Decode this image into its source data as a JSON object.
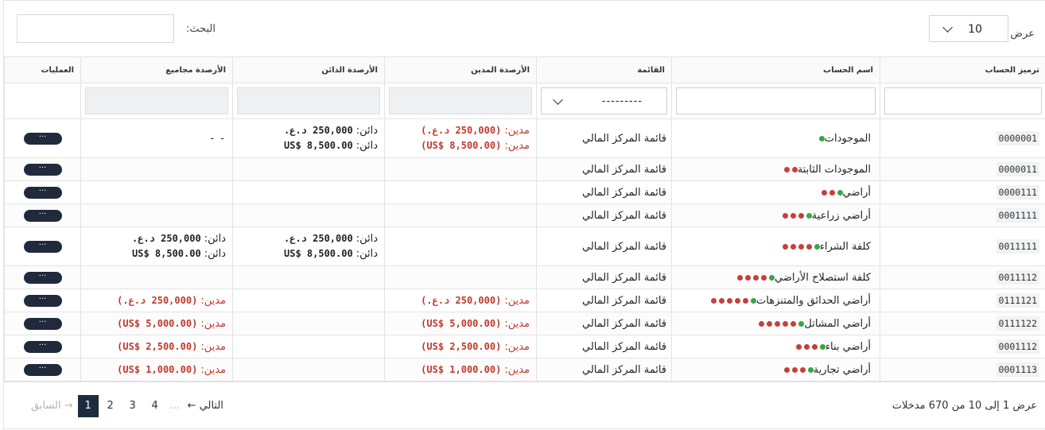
{
  "controls": {
    "show_label": "عرض",
    "page_size": "10",
    "search_label": "البحث:",
    "search_value": ""
  },
  "columns": {
    "code": "ترميز الحساب",
    "name": "اسم الحساب",
    "list": "القائمة",
    "debit": "الأرصدة المدين",
    "credit": "الأرصدة الدائن",
    "totals": "الأرصدة مجاميع",
    "ops": "العمليات"
  },
  "filters": {
    "list_placeholder": "---------"
  },
  "labels": {
    "debit": "مدين:",
    "credit": "دائن:",
    "ops_button": "···",
    "dash": "- -"
  },
  "rows": [
    {
      "code": "0000001",
      "name": "الموجودات",
      "red_dots": 0,
      "green_dots": 1,
      "list": "قائمة المركز المالي",
      "debit": [
        "(250,000 د.ع.)",
        "(US$ 8,500.00)"
      ],
      "credit": [
        "250,000 د.ع.",
        "US$ 8,500.00"
      ],
      "totals": "- -"
    },
    {
      "code": "0000011",
      "name": "الموجودات الثابتة",
      "red_dots": 2,
      "green_dots": 0,
      "list": "قائمة المركز المالي"
    },
    {
      "code": "0000111",
      "name": "أراضي",
      "red_dots": 2,
      "green_dots": 1,
      "list": "قائمة المركز المالي"
    },
    {
      "code": "0001111",
      "name": "أراضي زراعية",
      "red_dots": 3,
      "green_dots": 1,
      "list": "قائمة المركز المالي"
    },
    {
      "code": "0011111",
      "name": "كلفة الشراء",
      "red_dots": 4,
      "green_dots": 1,
      "list": "قائمة المركز المالي",
      "credit": [
        "250,000 د.ع.",
        "US$ 8,500.00"
      ],
      "totals_credit": [
        "250,000 د.ع.",
        "US$ 8,500.00"
      ]
    },
    {
      "code": "0011112",
      "name": "كلفة استصلاح الأراضي",
      "red_dots": 4,
      "green_dots": 1,
      "list": "قائمة المركز المالي"
    },
    {
      "code": "0111121",
      "name": "أراضي الحدائق والمتنزهات",
      "red_dots": 5,
      "green_dots": 1,
      "list": "قائمة المركز المالي",
      "debit": [
        "(250,000 د.ع.)"
      ],
      "totals_debit": [
        "(250,000 د.ع.)"
      ]
    },
    {
      "code": "0111122",
      "name": "أراضي المشاتل",
      "red_dots": 5,
      "green_dots": 1,
      "list": "قائمة المركز المالي",
      "debit": [
        "(US$ 5,000.00)"
      ],
      "totals_debit": [
        "(US$ 5,000.00)"
      ]
    },
    {
      "code": "0001112",
      "name": "أراضي بناء",
      "red_dots": 3,
      "green_dots": 1,
      "list": "قائمة المركز المالي",
      "debit": [
        "(US$ 2,500.00)"
      ],
      "totals_debit": [
        "(US$ 2,500.00)"
      ]
    },
    {
      "code": "0001113",
      "name": "أراضي تجارية",
      "red_dots": 3,
      "green_dots": 1,
      "list": "قائمة المركز المالي",
      "debit": [
        "(US$ 1,000.00)"
      ],
      "totals_debit": [
        "(US$ 1,000.00)"
      ]
    }
  ],
  "footer": {
    "summary": "عرض 1 إلى 10 من 670 مدخلات",
    "prev": "→ السابق",
    "pages": [
      "1",
      "2",
      "3",
      "4"
    ],
    "ellipsis": "...",
    "next": "التالي ←"
  },
  "colors": {
    "debit": "#c0392b",
    "dot_green": "#35a845",
    "dot_red": "#c5403a",
    "button_dark": "#202a3c"
  }
}
